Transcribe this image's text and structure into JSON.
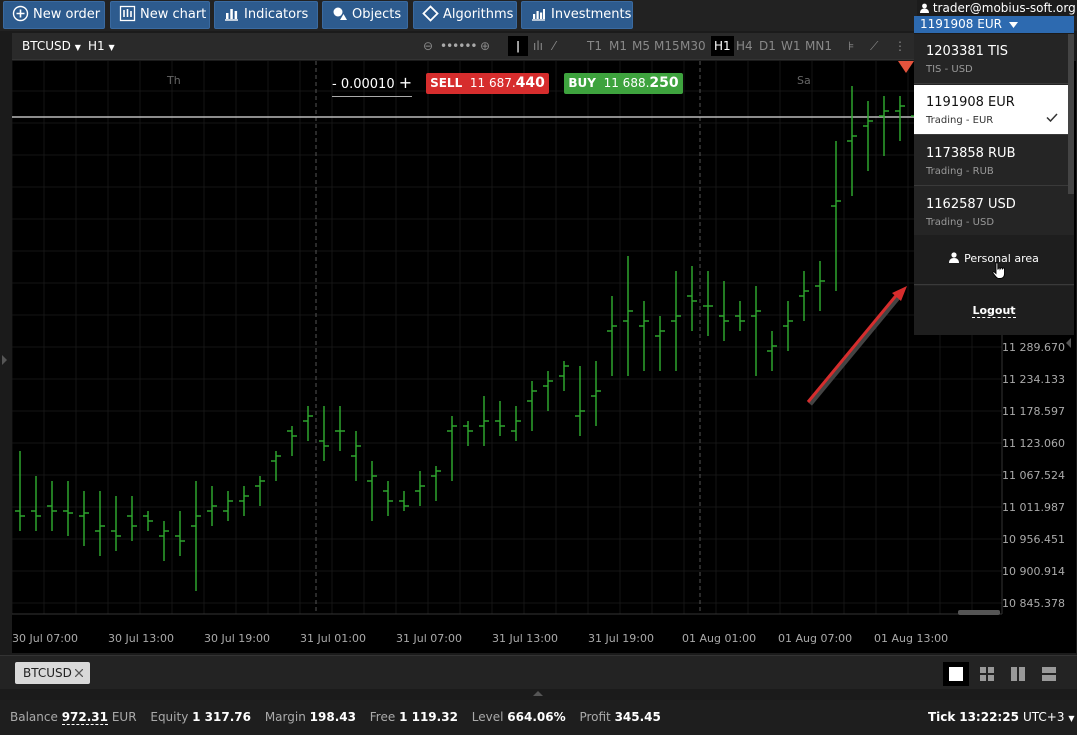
{
  "toolbar": {
    "new_order": "New order",
    "new_chart": "New chart",
    "indicators": "Indicators",
    "objects": "Objects",
    "algorithms": "Algorithms",
    "investments": "Investments"
  },
  "user": {
    "email": "trader@mobius-soft.org",
    "account_selected": "1191908 EUR"
  },
  "chart_toolbar": {
    "symbol": "BTCUSD",
    "interval": "H1",
    "timeframes": [
      "T1",
      "M1",
      "M5",
      "M15",
      "M30",
      "H1",
      "H4",
      "D1",
      "W1",
      "MN1"
    ],
    "active_timeframe": "H1"
  },
  "trade": {
    "lot_prefix": "-",
    "lot_value": "0.00010",
    "lot_suffix": "+",
    "sell_label": "SELL",
    "sell_price_small": "11 687.",
    "sell_price_big": "440",
    "buy_label": "BUY",
    "buy_price_small": "11 688.",
    "buy_price_big": "250"
  },
  "chart": {
    "day_labels": [
      "Th",
      "Sa"
    ],
    "y_ticks": [
      "11 289.670",
      "11 234.133",
      "11 178.597",
      "11 123.060",
      "11 067.524",
      "11 011.987",
      "10 956.451",
      "10 900.914",
      "10 845.378"
    ],
    "x_ticks": [
      "30 Jul 07:00",
      "30 Jul 13:00",
      "30 Jul 19:00",
      "31 Jul 01:00",
      "31 Jul 07:00",
      "31 Jul 13:00",
      "31 Jul 19:00",
      "01 Aug 01:00",
      "01 Aug 07:00",
      "01 Aug 13:00"
    ],
    "bar_color": "#2ea42e",
    "arrow_color": "#d62d2d"
  },
  "accounts": [
    {
      "number": "1203381 TIS",
      "type": "TIS - USD",
      "selected": false
    },
    {
      "number": "1191908 EUR",
      "type": "Trading - EUR",
      "selected": true
    },
    {
      "number": "1173858 RUB",
      "type": "Trading - RUB",
      "selected": false
    },
    {
      "number": "1162587 USD",
      "type": "Trading - USD",
      "selected": false
    }
  ],
  "menu": {
    "personal_area": "Personal area",
    "logout": "Logout"
  },
  "tabs": [
    {
      "label": "BTCUSD"
    }
  ],
  "status": {
    "balance_label": "Balance",
    "balance": "972.31",
    "balance_ccy": "EUR",
    "equity_label": "Equity",
    "equity": "1 317.76",
    "margin_label": "Margin",
    "margin": "198.43",
    "free_label": "Free",
    "free": "1 119.32",
    "level_label": "Level",
    "level": "664.06%",
    "profit_label": "Profit",
    "profit": "345.45",
    "tick_label": "Tick",
    "tick": "13:22:25",
    "timezone": "UTC+3"
  }
}
